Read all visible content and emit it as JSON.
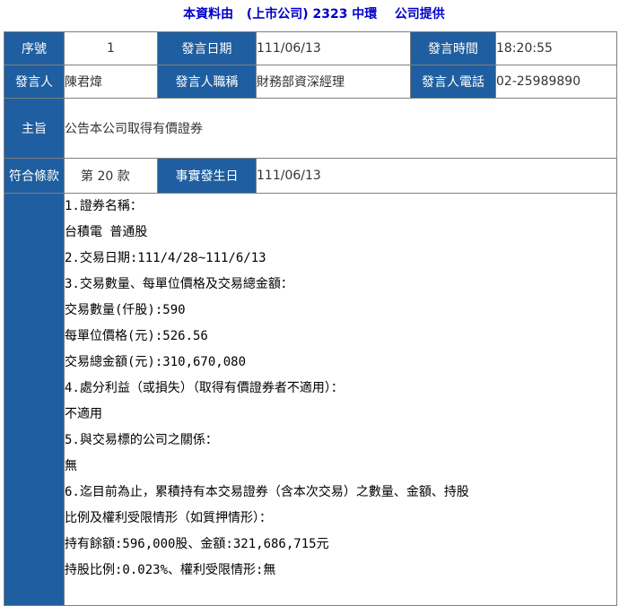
{
  "header": {
    "prefix": "本資料由",
    "company": "(上市公司) 2323 中環",
    "suffix": "公司提供"
  },
  "row1": {
    "seq_label": "序號",
    "seq_value": "1",
    "date_label": "發言日期",
    "date_value": "111/06/13",
    "time_label": "發言時間",
    "time_value": "18:20:55"
  },
  "row2": {
    "speaker_label": "發言人",
    "speaker_value": "陳君煒",
    "title_label": "發言人職稱",
    "title_value": "財務部資深經理",
    "phone_label": "發言人電話",
    "phone_value": "02-25989890"
  },
  "subject": {
    "label": "主旨",
    "value": "公告本公司取得有價證券"
  },
  "row4": {
    "clause_label": "符合條款",
    "clause_value": "第 20 款",
    "event_date_label": "事實發生日",
    "event_date_value": "111/06/13"
  },
  "body_lines": [
    "1.證券名稱：",
    "台積電 普通股",
    "2.交易日期:111/4/28~111/6/13",
    "3.交易數量、每單位價格及交易總金額：",
    "交易數量(仟股):590",
    "每單位價格(元):526.56",
    "交易總金額(元):310,670,080",
    "4.處分利益（或損失）（取得有價證券者不適用）：",
    "不適用",
    "5.與交易標的公司之關係：",
    "無",
    "6.迄目前為止，累積持有本交易證券（含本次交易）之數量、金額、持股",
    "比例及權利受限情形（如質押情形）：",
    "持有餘額:596,000股、金額:321,686,715元",
    "持股比例:0.023%、權利受限情形:無"
  ],
  "colors": {
    "label_bg": "#1f5ea0",
    "header_text": "#0000cc",
    "border": "#7f7f7f"
  }
}
